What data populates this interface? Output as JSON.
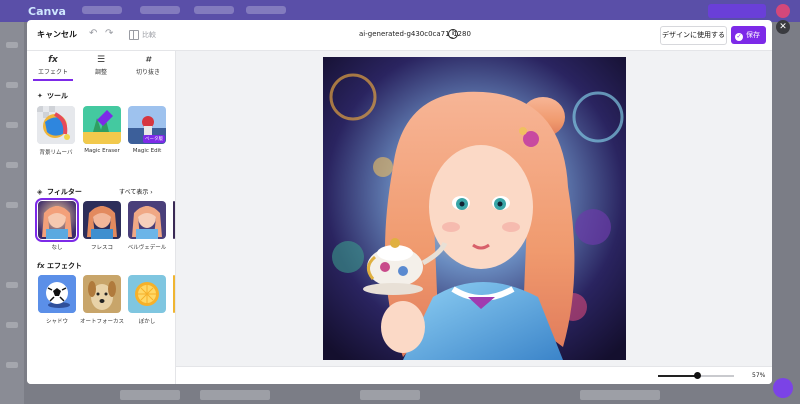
{
  "app": {
    "logo": "Canva"
  },
  "header": {
    "cancel_label": "キャンセル",
    "compare_label": "比較",
    "file_name": "ai-generated-g430c0ca71_1280",
    "use_in_design_label": "デザインに使用する",
    "save_label": "保存"
  },
  "tabs": [
    {
      "icon": "fx",
      "label": "エフェクト"
    },
    {
      "icon": "sliders-icon",
      "label": "調整"
    },
    {
      "icon": "crop-icon",
      "label": "切り抜き"
    }
  ],
  "tools": {
    "title": "ツール",
    "items": [
      {
        "label": "背景リムーバ"
      },
      {
        "label": "Magic Eraser"
      },
      {
        "label": "Magic Edit",
        "badge": "ベータ版"
      }
    ]
  },
  "filters": {
    "title": "フィルター",
    "see_all": "すべて表示",
    "items": [
      {
        "label": "なし",
        "selected": true
      },
      {
        "label": "フレスコ"
      },
      {
        "label": "ベルヴェデール"
      }
    ]
  },
  "effects": {
    "title": "エフェクト",
    "items": [
      {
        "label": "シャドウ"
      },
      {
        "label": "オートフォーカス"
      },
      {
        "label": "ぼかし"
      }
    ]
  },
  "zoom": {
    "value": 57,
    "label": "57%"
  },
  "colors": {
    "accent": "#7d2ae8"
  }
}
